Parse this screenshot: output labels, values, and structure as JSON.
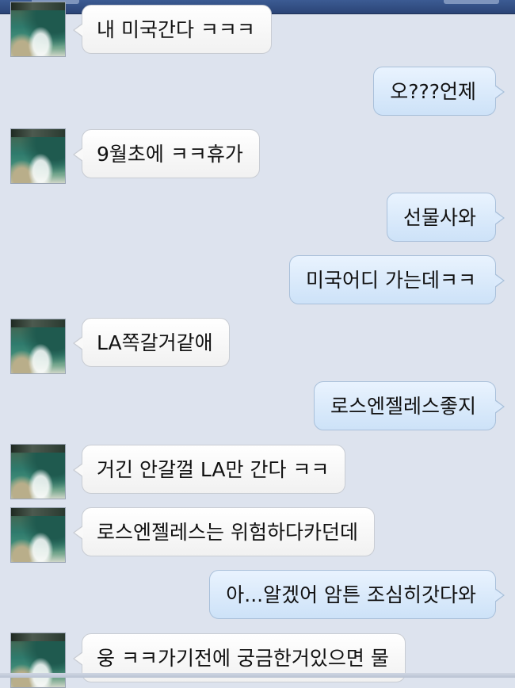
{
  "messages": [
    {
      "sender": "them",
      "text": "내 미국간다 ㅋㅋㅋ"
    },
    {
      "sender": "me",
      "text": "오???언제"
    },
    {
      "sender": "them",
      "text": "9월초에 ㅋㅋ휴가"
    },
    {
      "sender": "me",
      "text": "선물사와"
    },
    {
      "sender": "me",
      "text": "미국어디 가는데ㅋㅋ"
    },
    {
      "sender": "them",
      "text": "LA쪽갈거같애"
    },
    {
      "sender": "me",
      "text": "로스엔젤레스좋지"
    },
    {
      "sender": "them",
      "text": "거긴 안갈껄 LA만 간다 ㅋㅋ"
    },
    {
      "sender": "them",
      "text": "로스엔젤레스는 위험하다카던데"
    },
    {
      "sender": "me",
      "text": "아...알겠어 암튼 조심히갓다와"
    },
    {
      "sender": "them",
      "text": "웅 ㅋㅋ가기전에 궁금한거있으면 물"
    }
  ],
  "colors": {
    "background": "#dde3ee",
    "incoming_bubble": "#ffffff",
    "outgoing_bubble": "#cde2f8",
    "top_bar": "#2a4476"
  },
  "icons": {
    "avatar": "profile-photo"
  }
}
